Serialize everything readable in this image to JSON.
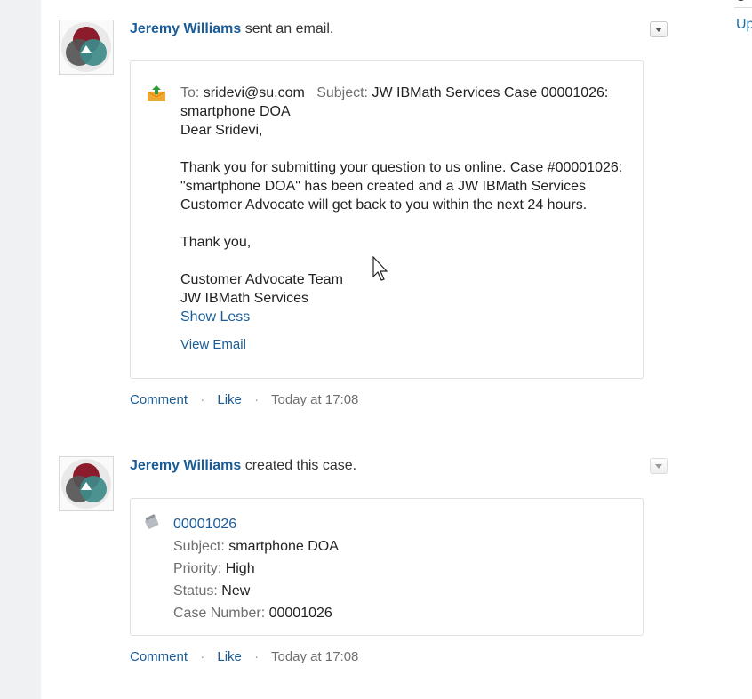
{
  "right_column": {
    "top_fragment": "C",
    "link_label": "Up"
  },
  "posts": [
    {
      "actor": "Jeremy Williams",
      "action": "sent an email.",
      "email": {
        "to_label": "To:",
        "to_value": "sridevi@su.com",
        "subject_label": "Subject:",
        "subject_value": "JW IBMath Services Case 00001026: smartphone DOA",
        "body": "Dear Sridevi,\n\nThank you for submitting your question to us online. Case #00001026: \"smartphone DOA\" has been created and a JW IBMath Services Customer Advocate will get back to you within the next 24 hours.\n\nThank you,\n\nCustomer Advocate Team\nJW IBMath Services",
        "show_less": "Show Less",
        "view_email": "View Email"
      },
      "footer": {
        "comment": "Comment",
        "like": "Like",
        "separator": "·",
        "timestamp": "Today at 17:08"
      }
    },
    {
      "actor": "Jeremy Williams",
      "action": "created this case.",
      "case": {
        "number_link": "00001026",
        "subject_label": "Subject:",
        "subject_value": "smartphone DOA",
        "priority_label": "Priority:",
        "priority_value": "High",
        "status_label": "Status:",
        "status_value": "New",
        "case_number_label": "Case Number:",
        "case_number_value": "00001026"
      },
      "footer": {
        "comment": "Comment",
        "like": "Like",
        "separator": "·",
        "timestamp": "Today at 17:08"
      }
    }
  ],
  "colors": {
    "link": "#1b5c97",
    "muted": "#6f6f6f",
    "email_icon": "#f0a830",
    "email_icon_arrow": "#2e9b3e",
    "avatar_red": "#8c1c2c",
    "avatar_teal": "#3d8a89",
    "avatar_gray": "#555555"
  },
  "icons": {
    "avatar": "venn-diagram-avatar",
    "email": "email-outbox-icon",
    "case": "case-icon",
    "menu": "chevron-down-icon",
    "cursor": "mouse-pointer"
  }
}
